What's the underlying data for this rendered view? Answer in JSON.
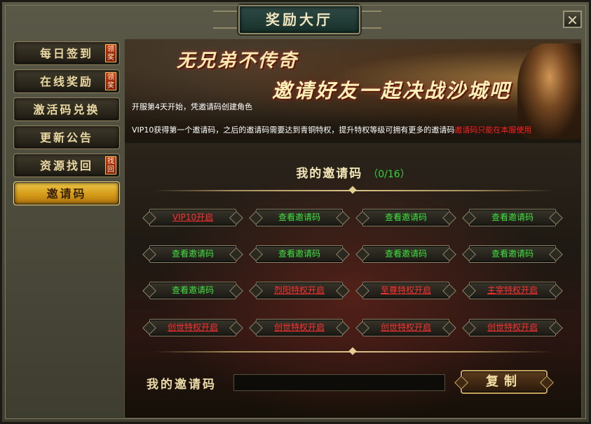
{
  "window": {
    "title": "奖励大厅",
    "close_label": "✕"
  },
  "sidebar": {
    "items": [
      {
        "label": "每日签到",
        "badge": "领奖",
        "active": false
      },
      {
        "label": "在线奖励",
        "badge": "领奖",
        "active": false
      },
      {
        "label": "激活码兑换",
        "badge": "",
        "active": false
      },
      {
        "label": "更新公告",
        "badge": "",
        "active": false
      },
      {
        "label": "资源找回",
        "badge": "找回",
        "active": false
      },
      {
        "label": "邀请码",
        "badge": "",
        "active": true
      }
    ]
  },
  "banner": {
    "slogan_line1": "无兄弟不传奇",
    "slogan_line2": "邀请好友一起决战沙城吧",
    "info_line1": "开服第4天开始，凭邀请码创建角色",
    "info_line2": "VIP10获得第一个邀请码，之后的邀请码需要达到青铜特权，提升特权等级可拥有更多的邀请码",
    "info_warning": "邀请码只能在本服使用"
  },
  "invite": {
    "title": "我的邀请码",
    "count_open": "（",
    "count": "0/16",
    "count_close": "）",
    "buttons": [
      {
        "label": "VIP10开启",
        "state": "locked"
      },
      {
        "label": "查看邀请码",
        "state": "view"
      },
      {
        "label": "查看邀请码",
        "state": "view"
      },
      {
        "label": "查看邀请码",
        "state": "view"
      },
      {
        "label": "查看邀请码",
        "state": "view"
      },
      {
        "label": "查看邀请码",
        "state": "view"
      },
      {
        "label": "查看邀请码",
        "state": "view"
      },
      {
        "label": "查看邀请码",
        "state": "view"
      },
      {
        "label": "查看邀请码",
        "state": "view"
      },
      {
        "label": "烈阳特权开启",
        "state": "locked"
      },
      {
        "label": "至尊特权开启",
        "state": "locked"
      },
      {
        "label": "主宰特权开启",
        "state": "locked"
      },
      {
        "label": "创世特权开启",
        "state": "locked"
      },
      {
        "label": "创世特权开启",
        "state": "locked"
      },
      {
        "label": "创世特权开启",
        "state": "locked"
      },
      {
        "label": "创世特权开启",
        "state": "locked"
      }
    ]
  },
  "footer": {
    "my_code_label": "我的邀请码",
    "my_code_value": "",
    "copy_label": "复制"
  },
  "colors": {
    "view_text": "#3fe23f",
    "locked_text": "#ff3030",
    "active_tab": "#d49a18",
    "warning_text": "#ff2020"
  }
}
